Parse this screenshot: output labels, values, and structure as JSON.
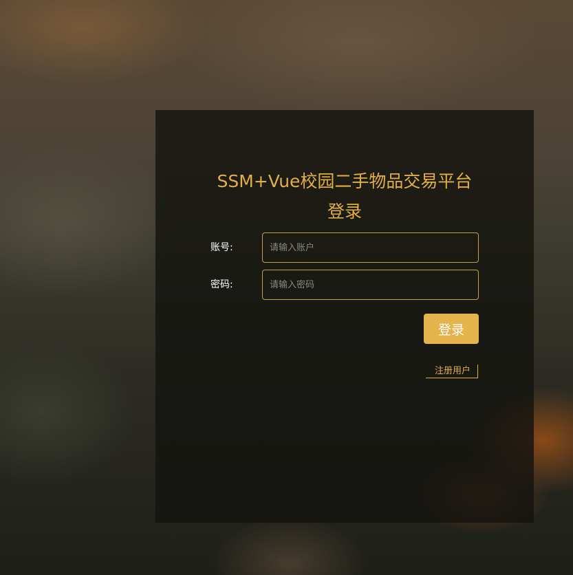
{
  "login": {
    "title": "SSM+Vue校园二手物品交易平台登录",
    "account_label": "账号:",
    "account_placeholder": "请输入账户",
    "account_value": "",
    "password_label": "密码:",
    "password_placeholder": "请输入密码",
    "password_value": "",
    "login_button": "登录",
    "register_link": "注册用户"
  },
  "colors": {
    "accent": "#e3ae44",
    "button": "#e3b34c",
    "panel": "#141410"
  }
}
